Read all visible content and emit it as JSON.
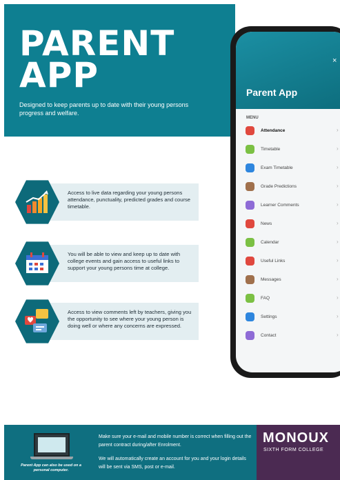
{
  "hero": {
    "title_line1": "PARENT",
    "title_line2": "APP",
    "subtitle": "Designed to keep parents up to date with their young persons progress and welfare."
  },
  "features": [
    {
      "icon": "bar-chart-icon",
      "text": "Access to live data regarding your young persons attendance, punctuality, predicted grades and course timetable."
    },
    {
      "icon": "calendar-icon",
      "text": "You will be able to view and keep up to date with college events and gain access to useful links to support your young persons time at college."
    },
    {
      "icon": "chat-bubbles-icon",
      "text": "Access to view comments left by teachers, giving you the opportunity to see where your young person is doing well or where any concerns are expressed."
    }
  ],
  "phone": {
    "title": "Parent App",
    "close": "×",
    "menu_label": "MENU",
    "items": [
      {
        "label": "Attendance",
        "color": "#e0483e"
      },
      {
        "label": "Timetable",
        "color": "#7bc043"
      },
      {
        "label": "Exam Timetable",
        "color": "#2e86de"
      },
      {
        "label": "Grade Predictions",
        "color": "#a0704c"
      },
      {
        "label": "Learner Comments",
        "color": "#8e6bd6"
      },
      {
        "label": "News",
        "color": "#e0483e"
      },
      {
        "label": "Calendar",
        "color": "#7bc043"
      },
      {
        "label": "Useful Links",
        "color": "#e0483e"
      },
      {
        "label": "Messages",
        "color": "#a0704c"
      },
      {
        "label": "FAQ",
        "color": "#7bc043"
      },
      {
        "label": "Settings",
        "color": "#2e86de"
      },
      {
        "label": "Contact",
        "color": "#8e6bd6"
      }
    ]
  },
  "footer": {
    "laptop_caption": "Parent App can also be used on a personal computer.",
    "line1": "Make sure your e-mail and mobile number is correct when filling out the parent contract during/after Enrolment.",
    "line2": "We will automatically create an account for you and your login details will be sent via SMS, post or e-mail.",
    "brand_name": "MONOUX",
    "brand_sub": "SIXTH FORM COLLEGE"
  },
  "colors": {
    "teal": "#0e7f91",
    "footer": "#0f6f80",
    "brand": "#4b2a52",
    "card": "#e3eef1"
  }
}
